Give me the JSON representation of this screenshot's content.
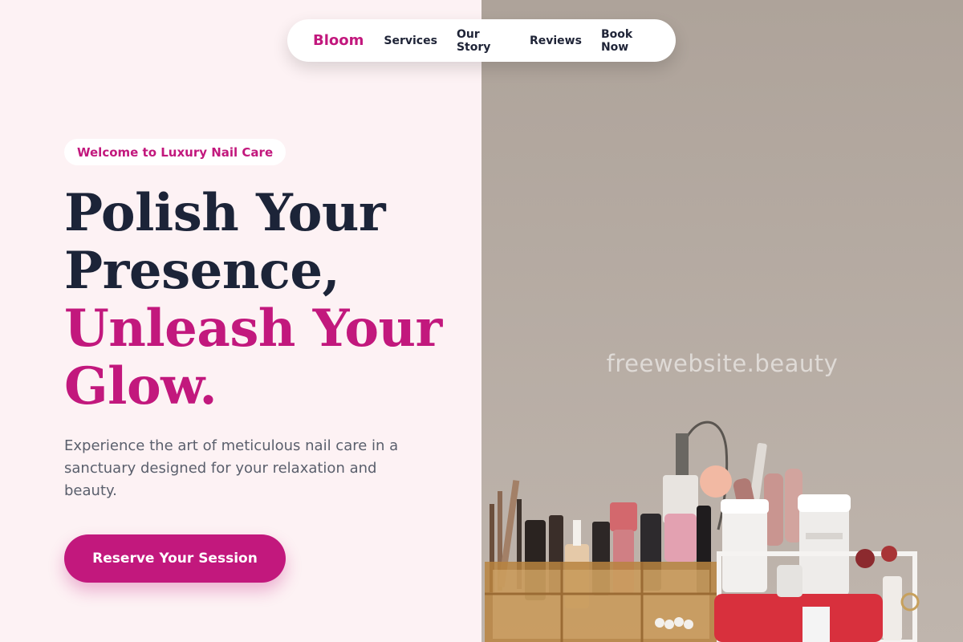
{
  "nav": {
    "brand": "Bloom",
    "links": [
      "Services",
      "Our Story",
      "Reviews",
      "Book Now"
    ]
  },
  "hero": {
    "badge": "Welcome to Luxury Nail Care",
    "headline_line1": "Polish Your",
    "headline_line2": "Presence,",
    "headline_line3": "Unleash Your",
    "headline_line4": "Glow.",
    "description": "Experience the art of meticulous nail care in a sanctuary designed for your relaxation and beauty.",
    "cta_label": "Reserve Your Session"
  },
  "watermark": "freewebsite.beauty",
  "colors": {
    "accent": "#c2187d",
    "heading": "#1c2438",
    "left_background": "#fdf2f4",
    "photo_wall": "#b7aca4"
  },
  "image": {
    "subject": "nail-supplies-organizer-photo"
  }
}
